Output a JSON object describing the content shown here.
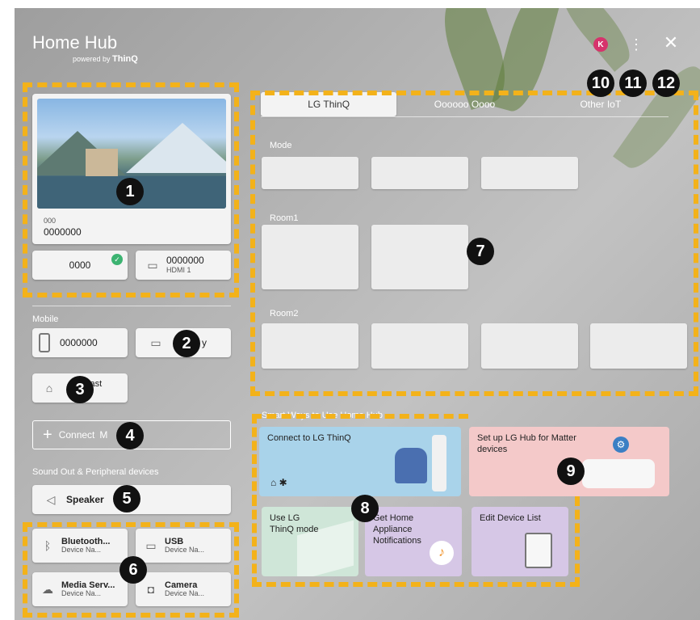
{
  "header": {
    "title": "Home Hub",
    "powered_prefix": "powered by ",
    "powered_brand": "ThinQ",
    "avatar_letter": "K",
    "more_glyph": "⋮",
    "close_glyph": "✕"
  },
  "callouts": [
    "1",
    "2",
    "3",
    "4",
    "5",
    "6",
    "7",
    "8",
    "9",
    "10",
    "11",
    "12"
  ],
  "tv": {
    "subtitle": "000",
    "name": "0000000",
    "input_left": "0000",
    "input_right": "0000000",
    "input_right_sub": "HDMI 1"
  },
  "mobile": {
    "section": "Mobile",
    "phone_name": "0000000",
    "airplay_label": "y",
    "cast_label_1": "cast",
    "cast_label_2": "h"
  },
  "connect": {
    "plus": "+",
    "label": "Connect",
    "label_tail": "M"
  },
  "sound": {
    "section": "Sound Out & Peripheral devices",
    "speaker": "Speaker"
  },
  "peripherals": [
    {
      "name": "Bluetooth...",
      "sub": "Device Na..."
    },
    {
      "name": "USB",
      "sub": "Device Na..."
    },
    {
      "name": "Media Serv...",
      "sub": "Device Na..."
    },
    {
      "name": "Camera",
      "sub": "Device Na..."
    }
  ],
  "tabs": [
    "LG ThinQ",
    "Oooooo Oooo",
    "Other IoT"
  ],
  "groups": {
    "mode": "Mode",
    "room1": "Room1",
    "room2": "Room2"
  },
  "smart": {
    "section": "Smart Ways to Use Home Hub",
    "connect_thinq": "Connect to LG ThinQ",
    "setup_matter": "Set up LG Hub for Matter devices",
    "use_thinq_mode": "Use LG ThinQ mode",
    "notifications": "Get Home Appliance Notifications",
    "edit_list": "Edit Device List"
  },
  "colors": {
    "accent_dash": "#f3b21a",
    "avatar": "#d6336c",
    "connect_card": "#a9d3ea",
    "matter_card": "#f4c9c9",
    "mode_card": "#cfe6d8",
    "notif_card": "#d6c7e6",
    "edit_card": "#d6c7e6",
    "check": "#3cb371"
  }
}
